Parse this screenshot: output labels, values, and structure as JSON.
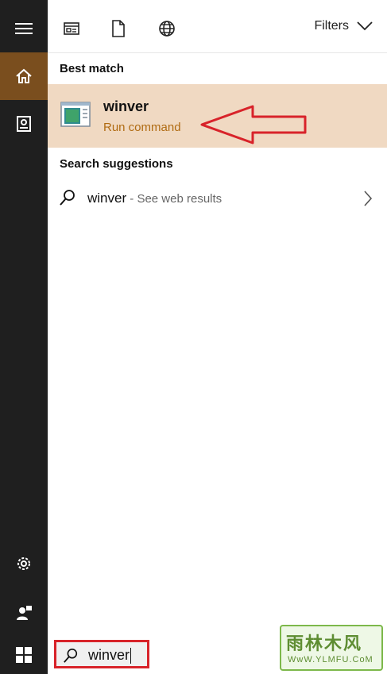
{
  "topbar": {
    "filters_label": "Filters"
  },
  "best_match": {
    "section_title": "Best match",
    "title": "winver",
    "subtitle": "Run command"
  },
  "suggestions": {
    "section_title": "Search suggestions",
    "items": [
      {
        "query": "winver",
        "suffix": " - See web results"
      }
    ]
  },
  "search": {
    "value": "winver"
  },
  "watermark": {
    "top": "雨林木风",
    "bottom": "WwW.YLMFU.CoM"
  },
  "colors": {
    "accent": "#7a4e1e",
    "highlight": "#f0d9c2",
    "subtitle": "#b06b12",
    "annotation": "#d8232a"
  },
  "icons": {
    "sidebar": [
      "hamburger-menu-icon",
      "home-icon",
      "notebook-icon",
      "gear-icon",
      "user-feedback-icon"
    ],
    "topbar": [
      "apps-icon",
      "documents-icon",
      "web-icon",
      "chevron-down-icon"
    ]
  }
}
